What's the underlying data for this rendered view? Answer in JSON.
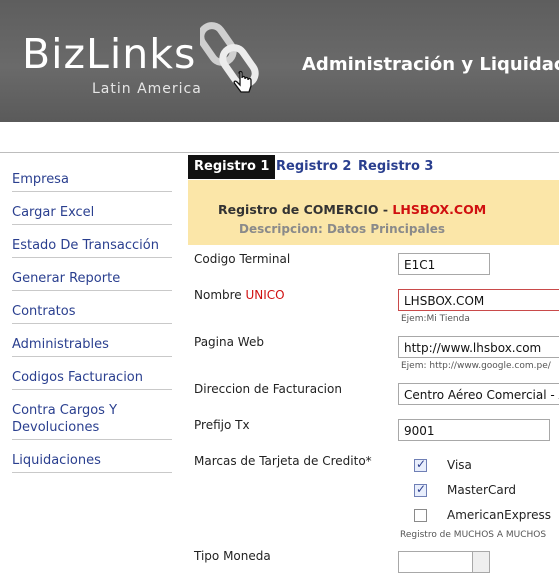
{
  "header": {
    "brand": "BizLinks",
    "brand_sub": "Latin America",
    "app_title": "Administración y Liquidac"
  },
  "sidebar": {
    "items": [
      {
        "label": "Empresa"
      },
      {
        "label": "Cargar Excel"
      },
      {
        "label": "Estado De Transacción"
      },
      {
        "label": "Generar Reporte"
      },
      {
        "label": "Contratos"
      },
      {
        "label": "Administrables"
      },
      {
        "label": "Codigos Facturacion"
      },
      {
        "label": "Contra Cargos Y Devoluciones"
      },
      {
        "label": "Liquidaciones"
      }
    ]
  },
  "tabs": [
    {
      "label": "Registro 1",
      "active": true
    },
    {
      "label": "Registro 2",
      "active": false
    },
    {
      "label": "Registro 3",
      "active": false
    }
  ],
  "banner": {
    "prefix": "Registro de COMERCIO - ",
    "name": "LHSBOX.COM",
    "subtitle": "Descripcion: Datos Principales"
  },
  "form": {
    "codigo_terminal": {
      "label": "Codigo Terminal",
      "value": "E1C1"
    },
    "nombre": {
      "label": "Nombre ",
      "label_required": "UNICO",
      "value": "LHSBOX.COM",
      "hint": "Ejem:Mi Tienda"
    },
    "pagina_web": {
      "label": "Pagina Web",
      "value": "http://www.lhsbox.com",
      "hint": "Ejem: http://www.google.com.pe/"
    },
    "direccion": {
      "label": "Direccion de Facturacion",
      "value": "Centro Aéreo Comercial - A"
    },
    "prefijo": {
      "label": "Prefijo Tx",
      "value": "9001"
    },
    "marcas": {
      "label": "Marcas de Tarjeta de Credito*",
      "options": [
        {
          "label": "Visa",
          "checked": true
        },
        {
          "label": "MasterCard",
          "checked": true
        },
        {
          "label": "AmericanExpress",
          "checked": false
        }
      ],
      "hint": "Registro de MUCHOS A MUCHOS"
    },
    "moneda": {
      "label": "Tipo Moneda"
    }
  },
  "colors": {
    "header_bg": "#5e5e5e",
    "link": "#2a3f8f",
    "banner_bg": "#fbe6a8",
    "required": "#d01010"
  }
}
